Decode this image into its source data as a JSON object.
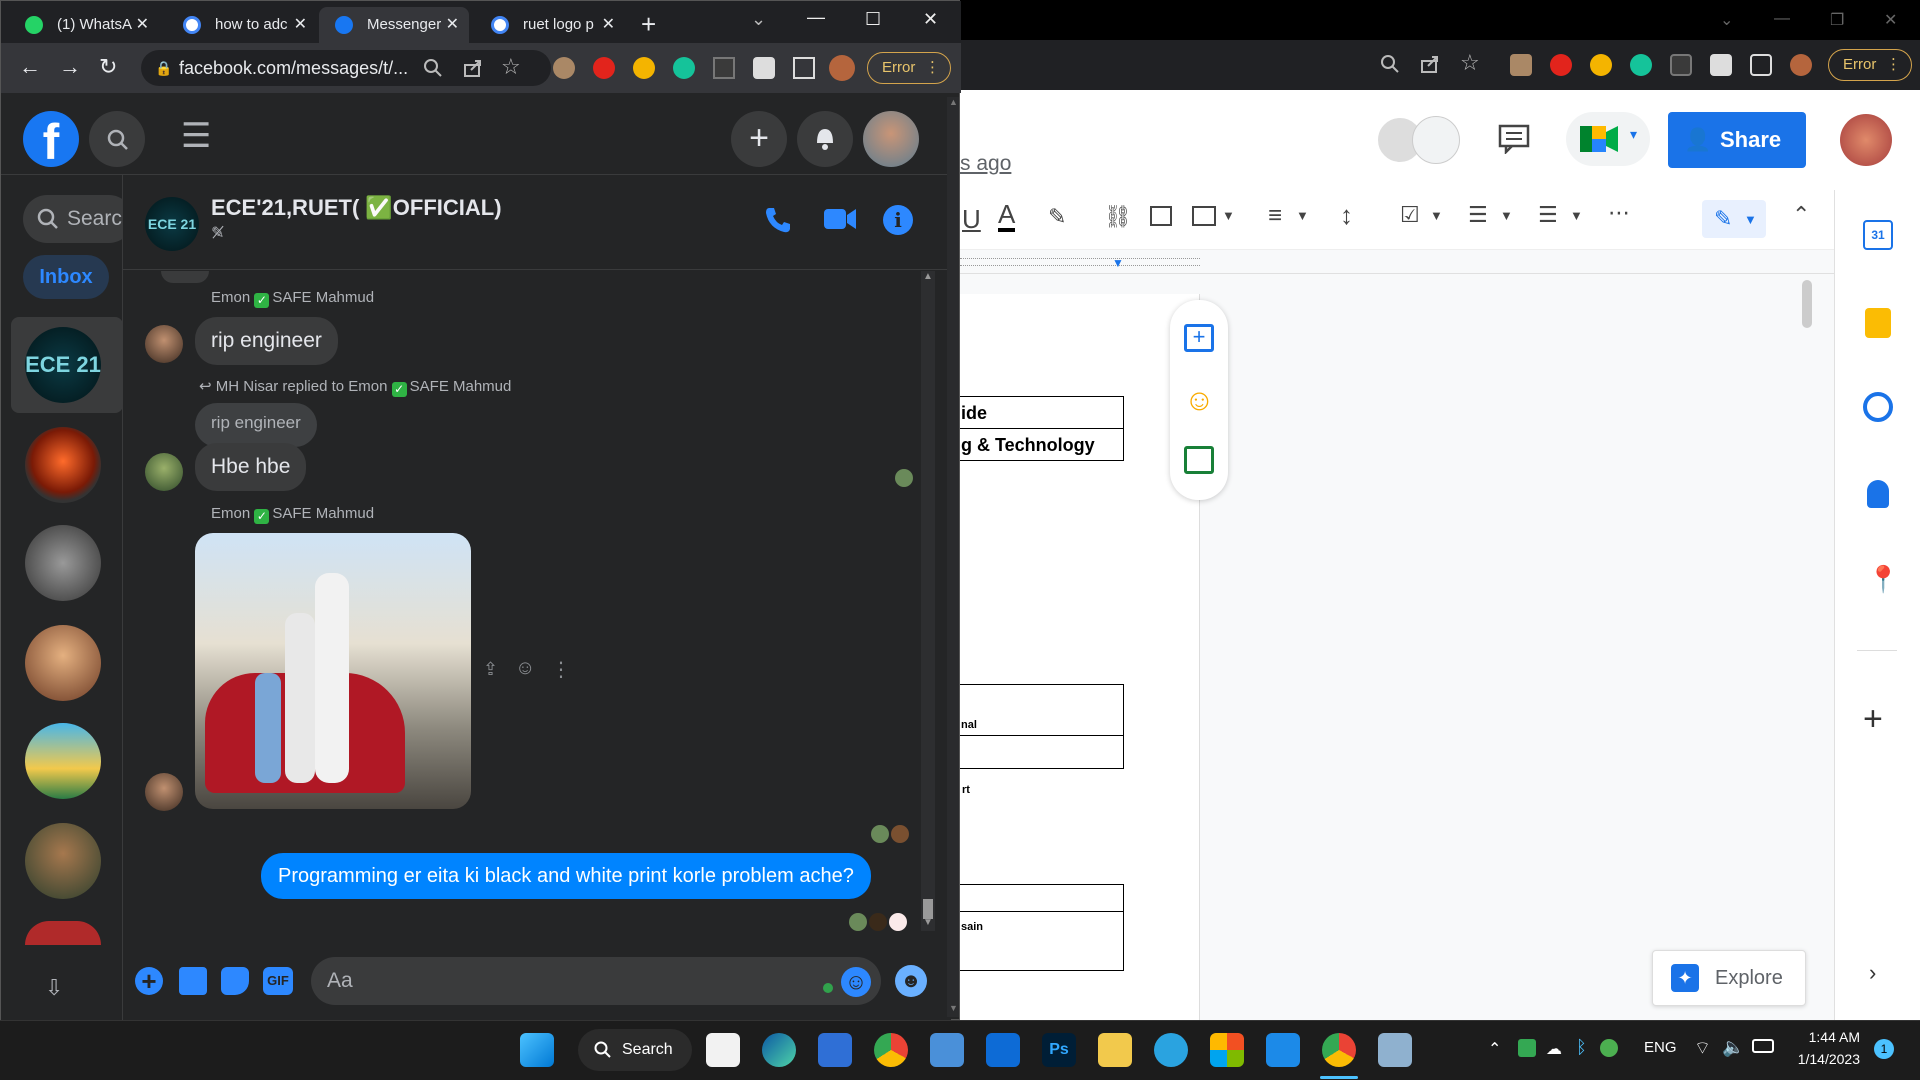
{
  "chrome_tabs": [
    {
      "title": "(1) WhatsA",
      "icon": "whatsapp-icon"
    },
    {
      "title": "how to adc",
      "icon": "google-icon"
    },
    {
      "title": "Messenger",
      "icon": "facebook-icon",
      "active": true
    },
    {
      "title": "ruet logo p",
      "icon": "google-icon"
    }
  ],
  "address_url": "facebook.com/messages/t/...",
  "error_label": "Error",
  "facebook": {
    "search_placeholder": "Search",
    "inbox_label": "Inbox",
    "chat_title": "ECE'21,RUET( ✅OFFICIAL)",
    "group_badge": "ECE 21"
  },
  "messages": {
    "m1_sender": "Emon",
    "m1_sender_rest": "SAFE Mahmud",
    "m1_text": "rip engineer",
    "m2_reply_line": "MH Nisar replied to Emon",
    "m2_reply_rest": "SAFE Mahmud",
    "m2_quoted": "rip engineer",
    "m2_text": "Hbe hbe",
    "m3_sender": "Emon",
    "m3_sender_rest": "SAFE Mahmud",
    "m4_text": "Programming er eita ki black and white print korle problem ache?"
  },
  "composer": {
    "placeholder": "Aa",
    "gif_label": "GIF"
  },
  "docs": {
    "edited_label": "s ago",
    "share_label": "Share",
    "explore_label": "Explore",
    "table1_row1": "ide",
    "table1_row2": "g & Technology",
    "table2_row1": "nal",
    "label_rt": "rt",
    "table3_row1": "sain"
  },
  "taskbar": {
    "search_label": "Search",
    "lang": "ENG",
    "time": "1:44 AM",
    "date": "1/14/2023",
    "notif_count": "1"
  }
}
